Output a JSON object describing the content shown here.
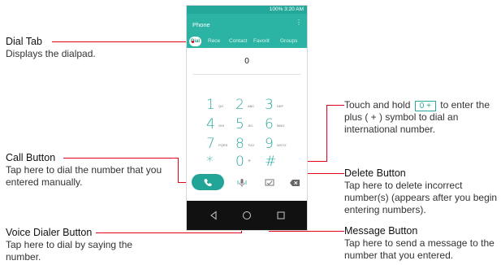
{
  "phone": {
    "status_text": "100% 3:20 AM",
    "title": "Phone",
    "tabs": [
      "Dial",
      "Rece",
      "Contact",
      "Favorit",
      "Groups"
    ],
    "number": "0",
    "keys": [
      {
        "n": "1",
        "l": "QO"
      },
      {
        "n": "2",
        "l": "ABC"
      },
      {
        "n": "3",
        "l": "DEF"
      },
      {
        "n": "4",
        "l": "GHI"
      },
      {
        "n": "5",
        "l": "JKL"
      },
      {
        "n": "6",
        "l": "MNO"
      },
      {
        "n": "7",
        "l": "PQRS"
      },
      {
        "n": "8",
        "l": "TUV"
      },
      {
        "n": "9",
        "l": "WXYZ"
      },
      {
        "n": "*",
        "l": ""
      },
      {
        "n": "0",
        "l": "+"
      },
      {
        "n": "#",
        "l": ""
      }
    ]
  },
  "callouts": {
    "dial_tab": {
      "title": "Dial Tab",
      "desc": "Displays the dialpad."
    },
    "call_button": {
      "title": "Call Button",
      "desc": "Tap here to dial the number that you entered manually."
    },
    "voice_dialer": {
      "title": "Voice Dialer Button",
      "desc": "Tap here to dial by saying the number."
    },
    "touch_hold": {
      "pre": "Touch and hold",
      "key": "0 +",
      "post": "to enter the plus ( + ) symbol to dial an international number."
    },
    "delete_button": {
      "title": "Delete Button",
      "desc": "Tap here to delete incorrect number(s) (appears after you begin entering numbers)."
    },
    "message_button": {
      "title": "Message Button",
      "desc": "Tap here to send a message to the number that you entered."
    }
  },
  "colors": {
    "accent": "#2bb3a3",
    "leader": "#e2001a"
  }
}
